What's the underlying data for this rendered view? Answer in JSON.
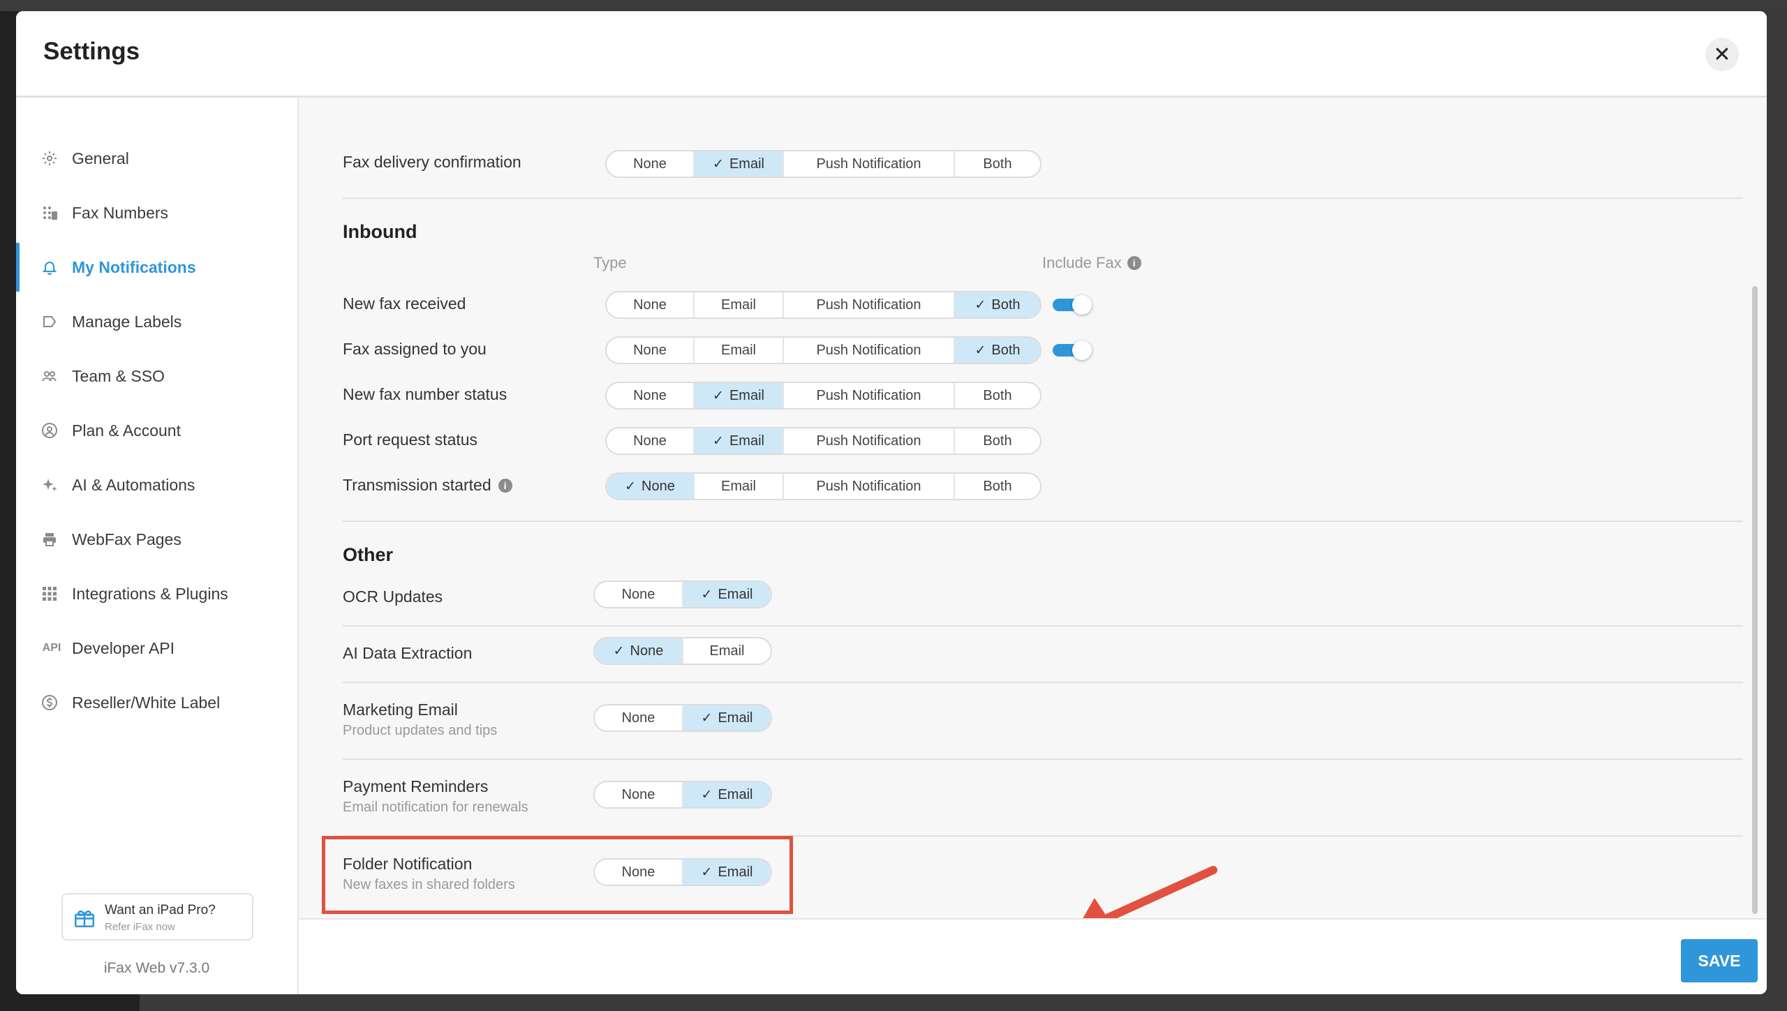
{
  "modal": {
    "title": "Settings"
  },
  "sidebar": {
    "items": [
      {
        "label": "General",
        "icon": "gear-icon"
      },
      {
        "label": "Fax Numbers",
        "icon": "fax-numbers-icon"
      },
      {
        "label": "My Notifications",
        "icon": "bell-icon",
        "active": true
      },
      {
        "label": "Manage Labels",
        "icon": "label-icon"
      },
      {
        "label": "Team & SSO",
        "icon": "team-icon"
      },
      {
        "label": "Plan & Account",
        "icon": "account-icon"
      },
      {
        "label": "AI & Automations",
        "icon": "sparkle-icon"
      },
      {
        "label": "WebFax Pages",
        "icon": "printer-icon"
      },
      {
        "label": "Integrations & Plugins",
        "icon": "grid-icon"
      },
      {
        "label": "Developer API",
        "icon": "api-icon"
      },
      {
        "label": "Reseller/White Label",
        "icon": "dollar-icon"
      }
    ],
    "promo": {
      "title": "Want an iPad Pro?",
      "subtitle": "Refer iFax now"
    },
    "version": "iFax Web v7.3.0"
  },
  "options4": {
    "none": "None",
    "email": "Email",
    "push": "Push Notification",
    "both": "Both"
  },
  "options2": {
    "none": "None",
    "email": "Email"
  },
  "top": {
    "fax_delivery_label": "Fax delivery confirmation",
    "fax_delivery_selected": "Email"
  },
  "inbound": {
    "title": "Inbound",
    "type_head": "Type",
    "include_fax_head": "Include Fax",
    "rows": [
      {
        "label": "New fax received",
        "selected": "Both",
        "include_fax": true
      },
      {
        "label": "Fax assigned to you",
        "selected": "Both",
        "include_fax": true
      },
      {
        "label": "New fax number status",
        "selected": "Email"
      },
      {
        "label": "Port request status",
        "selected": "Email"
      },
      {
        "label": "Transmission started",
        "selected": "None",
        "info": true
      }
    ]
  },
  "other": {
    "title": "Other",
    "rows": [
      {
        "label": "OCR Updates",
        "selected": "Email"
      },
      {
        "label": "AI Data Extraction",
        "selected": "None"
      },
      {
        "label": "Marketing Email",
        "sub": "Product updates and tips",
        "selected": "Email"
      },
      {
        "label": "Payment Reminders",
        "sub": "Email notification for renewals",
        "selected": "Email"
      },
      {
        "label": "Folder Notification",
        "sub": "New faxes in shared folders",
        "selected": "Email"
      }
    ]
  },
  "footer": {
    "save_label": "SAVE"
  },
  "colors": {
    "accent": "#2f96d9",
    "selected_bg": "#cfe8f8",
    "highlight": "#e0523f"
  }
}
